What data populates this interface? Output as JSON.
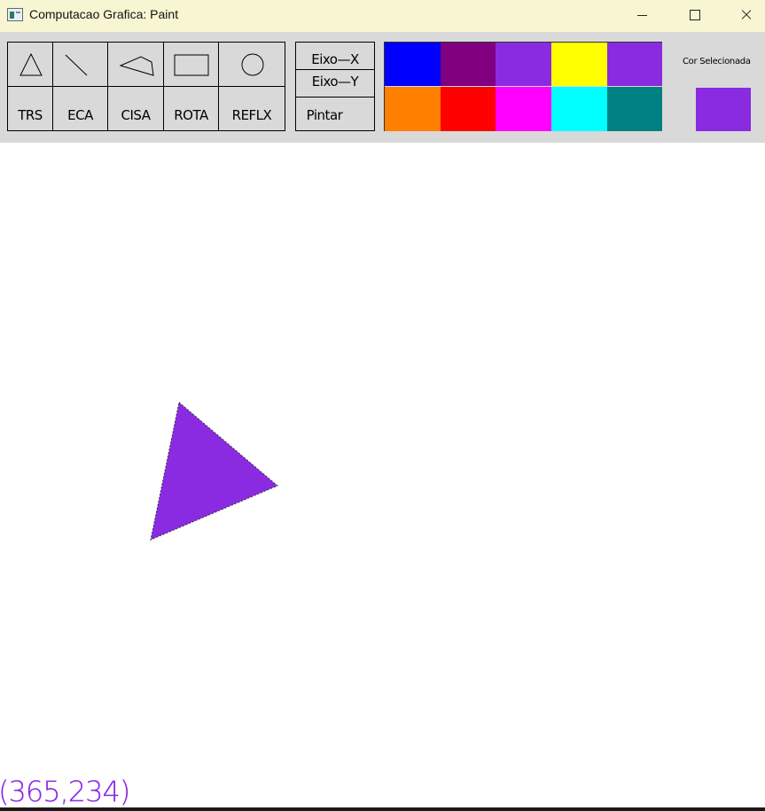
{
  "window": {
    "title": "Computacao Grafica: Paint",
    "icon": "app-window-icon",
    "controls": {
      "minimize": "minimize-icon",
      "maximize": "maximize-icon",
      "close": "close-icon"
    }
  },
  "toolbar": {
    "shapes": [
      {
        "id": "triangle",
        "icon": "triangle-icon"
      },
      {
        "id": "line",
        "icon": "line-icon"
      },
      {
        "id": "polygon",
        "icon": "polygon-icon"
      },
      {
        "id": "rectangle",
        "icon": "rectangle-icon"
      },
      {
        "id": "circle",
        "icon": "circle-icon"
      }
    ],
    "transforms": [
      "TRS",
      "ECA",
      "CISA",
      "ROTA",
      "REFLX"
    ],
    "reflect": {
      "axis_x": "Eixo—X",
      "axis_y": "Eixo—Y",
      "paint": "Pintar"
    },
    "palette": [
      "#0000ff",
      "#800080",
      "#8a2be2",
      "#ffff00",
      "#8a2be2",
      "#ff8000",
      "#ff0000",
      "#ff00ff",
      "#00ffff",
      "#008080"
    ],
    "selected_color_label": "Cor  Selecionada",
    "selected_color": "#8a2be2"
  },
  "canvas": {
    "mouse_coords": "(365,234)",
    "coords_color": "#8a2be2",
    "shape_fill": "#8a2be2"
  }
}
